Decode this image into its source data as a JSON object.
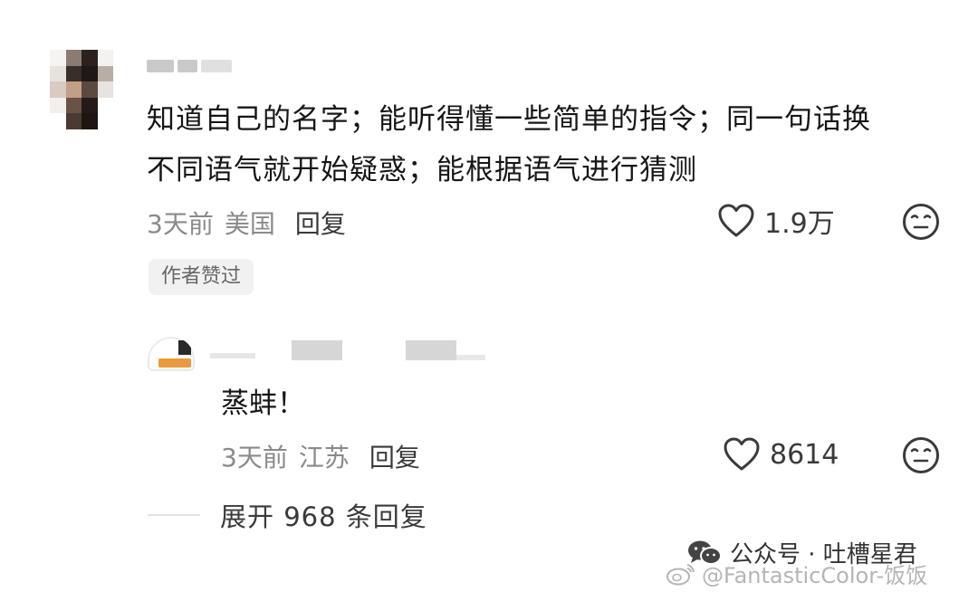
{
  "main_comment": {
    "text_line1": "知道自己的名字；能听得懂一些简单的指令；同一句话换",
    "text_line2": "不同语气就开始疑惑；能根据语气进行猜测",
    "time": "3天前",
    "region": "美国",
    "reply_label": "回复",
    "like_count": "1.9万",
    "author_badge": "作者赞过"
  },
  "reply_comment": {
    "text": "蒸蚌！",
    "time": "3天前",
    "region": "江苏",
    "reply_label": "回复",
    "like_count": "8614"
  },
  "expand": {
    "label": "展开 968 条回复"
  },
  "watermark": {
    "wechat": "公众号 · 吐槽星君",
    "weibo": "@FantasticColor-饭饭"
  },
  "icons": {
    "like": "heart-outline-icon",
    "dislike": "neutral-face-icon",
    "wechat": "wechat-icon",
    "weibo": "weibo-icon"
  }
}
